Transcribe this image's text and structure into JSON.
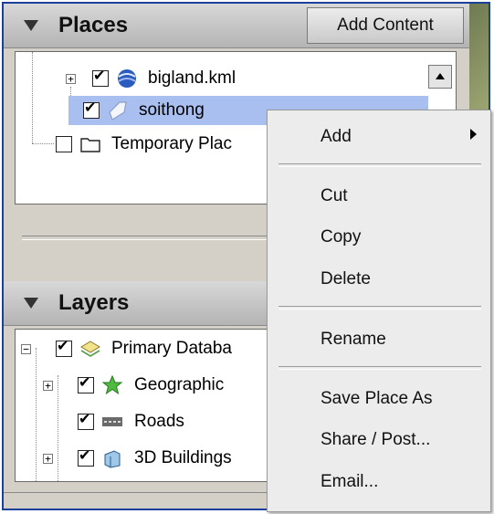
{
  "places": {
    "title": "Places",
    "add_content_label": "Add Content",
    "items": [
      {
        "label": "bigland.kml",
        "checked": true,
        "icon": "globe-icon"
      },
      {
        "label": "soithong",
        "checked": true,
        "icon": "polygon-icon",
        "selected": true
      },
      {
        "label": "Temporary Plac",
        "checked": false,
        "icon": "folder-icon"
      }
    ]
  },
  "layers": {
    "title": "Layers",
    "items": [
      {
        "label": "Primary Databa",
        "checked": true,
        "icon": "layers-icon"
      },
      {
        "label": "Geographic",
        "checked": true,
        "icon": "star-icon"
      },
      {
        "label": "Roads",
        "checked": true,
        "icon": "road-icon"
      },
      {
        "label": "3D Buildings",
        "checked": true,
        "icon": "building-icon"
      }
    ]
  },
  "context_menu": {
    "add": "Add",
    "cut": "Cut",
    "copy": "Copy",
    "delete": "Delete",
    "rename": "Rename",
    "save_place_as": "Save Place As",
    "share_post": "Share / Post...",
    "email": "Email..."
  },
  "colors": {
    "selection": "#a9bff0",
    "frame_border": "#1c3f9a",
    "panel_bg": "#d4d0c8",
    "menu_bg": "#ececec"
  }
}
